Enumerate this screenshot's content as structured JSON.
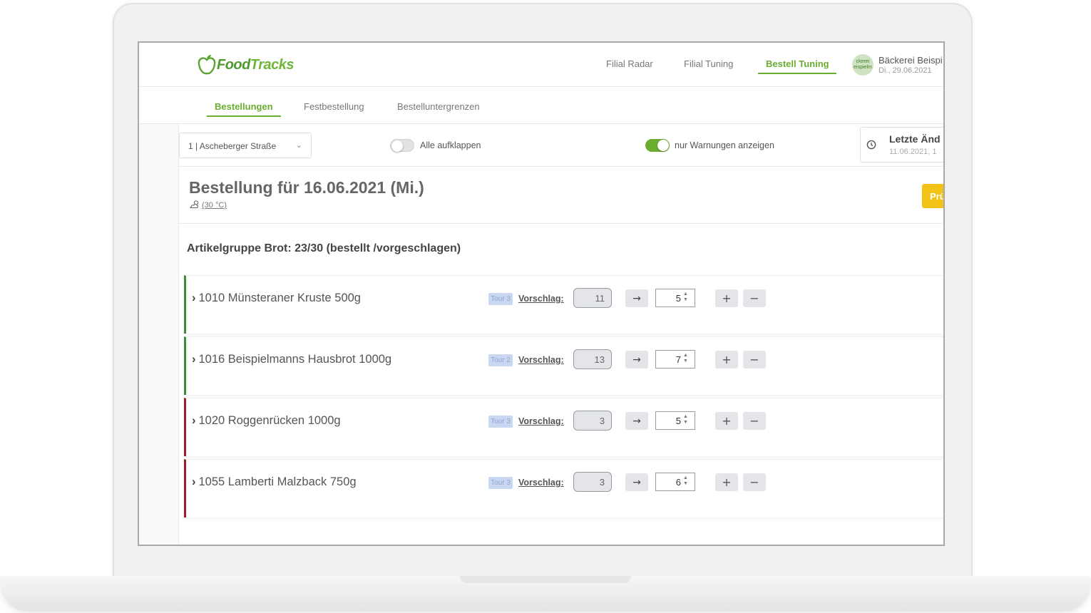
{
  "app": {
    "logo_text_1": "Food",
    "logo_text_2": "Tracks",
    "brand_color": "#6aad2f"
  },
  "nav": {
    "items": [
      {
        "label": "Filial Radar"
      },
      {
        "label": "Filial Tuning"
      },
      {
        "label": "Bestell Tuning",
        "active": true
      }
    ]
  },
  "user": {
    "avatar_text": "ckerei eispielm",
    "name": "Bäckerei Beispi",
    "date": "Di., 29.06.2021"
  },
  "subtabs": [
    {
      "label": "Bestellungen",
      "active": true
    },
    {
      "label": "Festbestellung"
    },
    {
      "label": "Bestelluntergrenzen"
    }
  ],
  "filters": {
    "branch_value": "1 | Ascheberger Straße",
    "expand_all_label": "Alle aufklappen",
    "expand_all_on": false,
    "warnings_only_label": "nur Warnungen anzeigen",
    "warnings_only_on": true,
    "last_change_title": "Letzte Änd",
    "last_change_date": "11.06.2021, 1"
  },
  "order": {
    "title": "Bestellung für 16.06.2021 (Mi.)",
    "weather": "(30 °C)",
    "check_button": "Prü",
    "check_button_color": "#f2c316"
  },
  "group": {
    "title": "Artikelgruppe Brot: 23/30 (bestellt /vorgeschlagen)"
  },
  "articles": [
    {
      "name": "1010 Münsteraner Kruste 500g",
      "tour": "Tour 3",
      "suggestion_label": "Vorschlag:",
      "suggestion": "11",
      "quantity": "5",
      "status": "ok"
    },
    {
      "name": "1016 Beispielmanns Hausbrot 1000g",
      "tour": "Tour 2",
      "suggestion_label": "Vorschlag:",
      "suggestion": "13",
      "quantity": "7",
      "status": "ok"
    },
    {
      "name": "1020 Roggenrücken 1000g",
      "tour": "Tour 3",
      "suggestion_label": "Vorschlag:",
      "suggestion": "3",
      "quantity": "5",
      "status": "warn"
    },
    {
      "name": "1055 Lamberti Malzback 750g",
      "tour": "Tour 3",
      "suggestion_label": "Vorschlag:",
      "suggestion": "3",
      "quantity": "6",
      "status": "warn"
    }
  ],
  "colors": {
    "ok_stripe": "#3d8f37",
    "warn_stripe": "#9b1c24"
  }
}
